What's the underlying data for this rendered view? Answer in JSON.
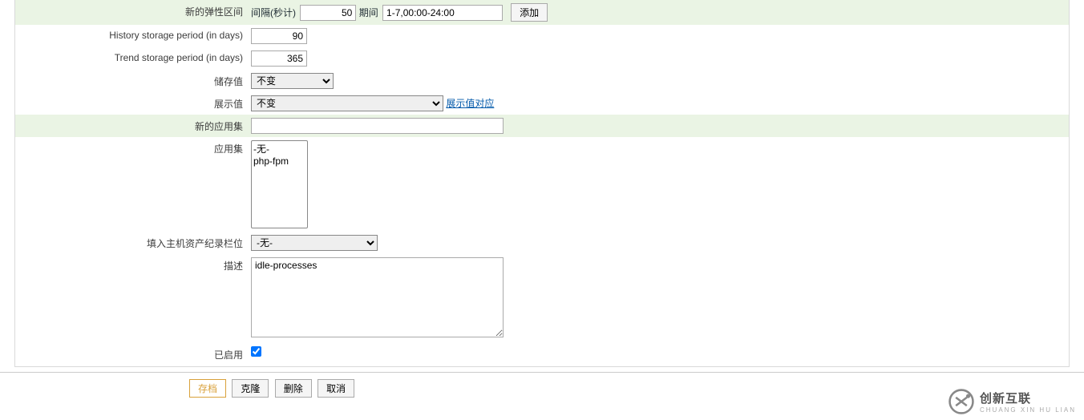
{
  "rows": {
    "flexInterval": {
      "label": "新的弹性区间",
      "intervalLabel": "间隔(秒计)",
      "intervalValue": "50",
      "periodLabel": "期间",
      "periodValue": "1-7,00:00-24:00",
      "addBtn": "添加"
    },
    "history": {
      "label": "History storage period (in days)",
      "value": "90"
    },
    "trend": {
      "label": "Trend storage period (in days)",
      "value": "365"
    },
    "storeValue": {
      "label": "储存值",
      "selected": "不变"
    },
    "displayValue": {
      "label": "展示值",
      "selected": "不变",
      "link": "展示值对应"
    },
    "newAppSet": {
      "label": "新的应用集",
      "value": ""
    },
    "appSet": {
      "label": "应用集",
      "options": [
        "-无-",
        "php-fpm"
      ]
    },
    "hostInventory": {
      "label": "填入主机资产纪录栏位",
      "selected": "-无-"
    },
    "description": {
      "label": "描述",
      "value": "idle-processes"
    },
    "enabled": {
      "label": "已启用",
      "checked": true
    }
  },
  "footer": {
    "save": "存档",
    "clone": "克隆",
    "delete": "删除",
    "cancel": "取消"
  },
  "logo": {
    "main": "创新互联",
    "sub": "CHUANG XIN HU LIAN"
  }
}
